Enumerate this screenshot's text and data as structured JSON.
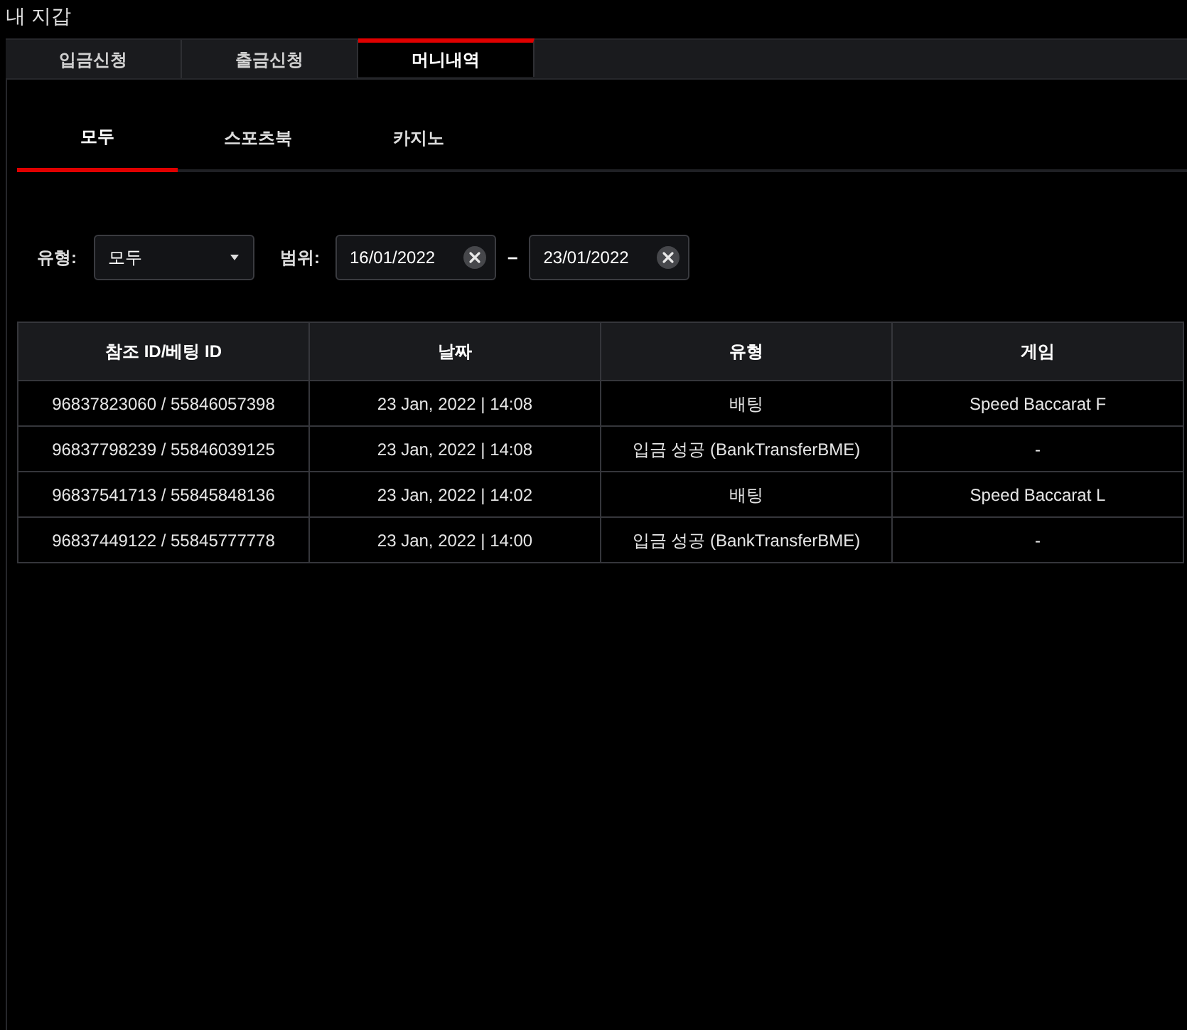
{
  "title": "내 지갑",
  "tabs": [
    {
      "label": "입금신청",
      "selected": false
    },
    {
      "label": "출금신청",
      "selected": false
    },
    {
      "label": "머니내역",
      "selected": true
    }
  ],
  "sub_tabs": [
    {
      "label": "모두",
      "selected": true
    },
    {
      "label": "스포츠북",
      "selected": false
    },
    {
      "label": "카지노",
      "selected": false
    }
  ],
  "filters": {
    "type_label": "유형:",
    "type_select": {
      "value": "모두"
    },
    "range_label": "범위:",
    "date_from": {
      "value": "16/01/2022"
    },
    "separator": "–",
    "date_to": {
      "value": "23/01/2022"
    }
  },
  "table": {
    "columns": [
      "참조 ID/베팅 ID",
      "날짜",
      "유형",
      "게임"
    ],
    "rows": [
      [
        "96837823060 / 55846057398",
        "23 Jan, 2022 | 14:08",
        "배팅",
        "Speed Baccarat F"
      ],
      [
        "96837798239 / 55846039125",
        "23 Jan, 2022 | 14:08",
        "입금 성공 (BankTransferBME)",
        "-"
      ],
      [
        "96837541713 / 55845848136",
        "23 Jan, 2022 | 14:02",
        "배팅",
        "Speed Baccarat L"
      ],
      [
        "96837449122 / 55845777778",
        "23 Jan, 2022 | 14:00",
        "입금 성공 (BankTransferBME)",
        "-"
      ]
    ]
  }
}
